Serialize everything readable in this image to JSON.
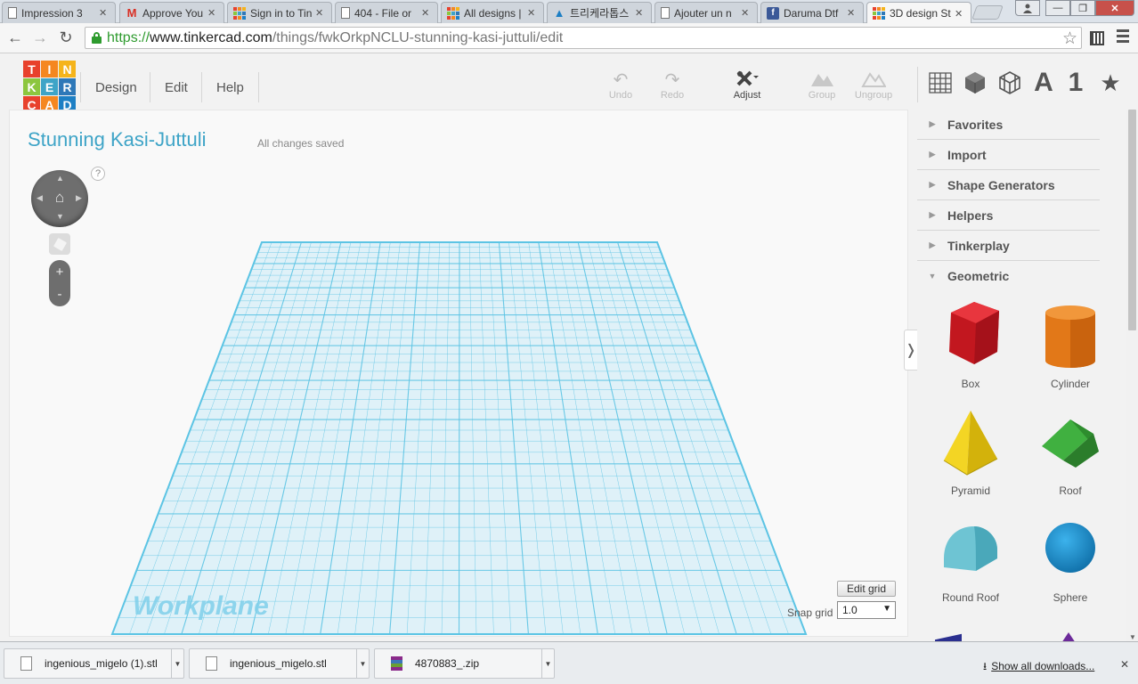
{
  "browser": {
    "tabs": [
      {
        "title": "Impression 3",
        "favicon": "document-icon"
      },
      {
        "title": "Approve You",
        "favicon": "gmail-icon"
      },
      {
        "title": "Sign in to Tin",
        "favicon": "tinkercad-icon"
      },
      {
        "title": "404 - File or",
        "favicon": "document-icon"
      },
      {
        "title": "All designs |",
        "favicon": "tinkercad-icon"
      },
      {
        "title": "트리케라톱스",
        "favicon": "adobe-icon"
      },
      {
        "title": "Ajouter un n",
        "favicon": "document-icon"
      },
      {
        "title": "Daruma Dtf",
        "favicon": "facebook-icon"
      },
      {
        "title": "3D design St",
        "favicon": "tinkercad-icon"
      }
    ],
    "active_tab_index": 8,
    "url": {
      "scheme": "https://",
      "host": "www.tinkercad.com",
      "path": "/things/fwkOrkpNCLU-stunning-kasi-juttuli/edit"
    },
    "window_close_glyph": "✕",
    "window_min_glyph": "—",
    "window_max_glyph": "❐"
  },
  "app": {
    "logo_letters": [
      "T",
      "I",
      "N",
      "K",
      "E",
      "R",
      "C",
      "A",
      "D"
    ],
    "logo_colors": [
      "#e8412c",
      "#f58720",
      "#f5b41b",
      "#8cc63e",
      "#3ea4c7",
      "#2e78b8",
      "#e8412c",
      "#f58720",
      "#1d7fc4"
    ],
    "menu": [
      "Design",
      "Edit",
      "Help"
    ],
    "tools": [
      {
        "label": "Undo",
        "enabled": false,
        "icon": "undo-icon"
      },
      {
        "label": "Redo",
        "enabled": false,
        "icon": "redo-icon"
      },
      {
        "label": "Adjust",
        "enabled": true,
        "icon": "adjust-icon"
      },
      {
        "label": "Group",
        "enabled": false,
        "icon": "group-icon"
      },
      {
        "label": "Ungroup",
        "enabled": false,
        "icon": "ungroup-icon"
      }
    ],
    "view_icons": [
      "grid-view-icon",
      "cube-view-icon",
      "wireframe-view-icon",
      "text-view-icon",
      "number-view-icon",
      "favorites-star-icon"
    ],
    "view_text_a": "A",
    "view_text_1": "1"
  },
  "workspace": {
    "design_title": "Stunning Kasi-Juttuli",
    "save_status": "All changes saved",
    "help_text": "?",
    "zoom_in": "+",
    "zoom_out": "-",
    "workplane_label": "Workplane",
    "edit_grid_label": "Edit grid",
    "snap_grid_label": "Snap grid",
    "snap_grid_value": "1.0",
    "collapse_glyph": "❭",
    "grid_color": "#5cc4e4",
    "plane_color": "#dff1f8"
  },
  "sidebar": {
    "categories": [
      {
        "label": "Favorites",
        "expanded": false
      },
      {
        "label": "Import",
        "expanded": false
      },
      {
        "label": "Shape Generators",
        "expanded": false
      },
      {
        "label": "Helpers",
        "expanded": false
      },
      {
        "label": "Tinkerplay",
        "expanded": false
      },
      {
        "label": "Geometric",
        "expanded": true
      }
    ],
    "shapes": [
      {
        "label": "Box",
        "color": "#d7202c"
      },
      {
        "label": "Cylinder",
        "color": "#e8791c"
      },
      {
        "label": "Pyramid",
        "color": "#f1cf1f"
      },
      {
        "label": "Roof",
        "color": "#3aa53a"
      },
      {
        "label": "Round Roof",
        "color": "#6fc3d2"
      },
      {
        "label": "Sphere",
        "color": "#1f8fd0"
      }
    ]
  },
  "downloads": {
    "items": [
      {
        "name": "ingenious_migelo (1).stl",
        "type": "file"
      },
      {
        "name": "ingenious_migelo.stl",
        "type": "file"
      },
      {
        "name": "4870883_.zip",
        "type": "zip"
      }
    ],
    "show_all": "Show all downloads...",
    "close_glyph": "✕"
  }
}
